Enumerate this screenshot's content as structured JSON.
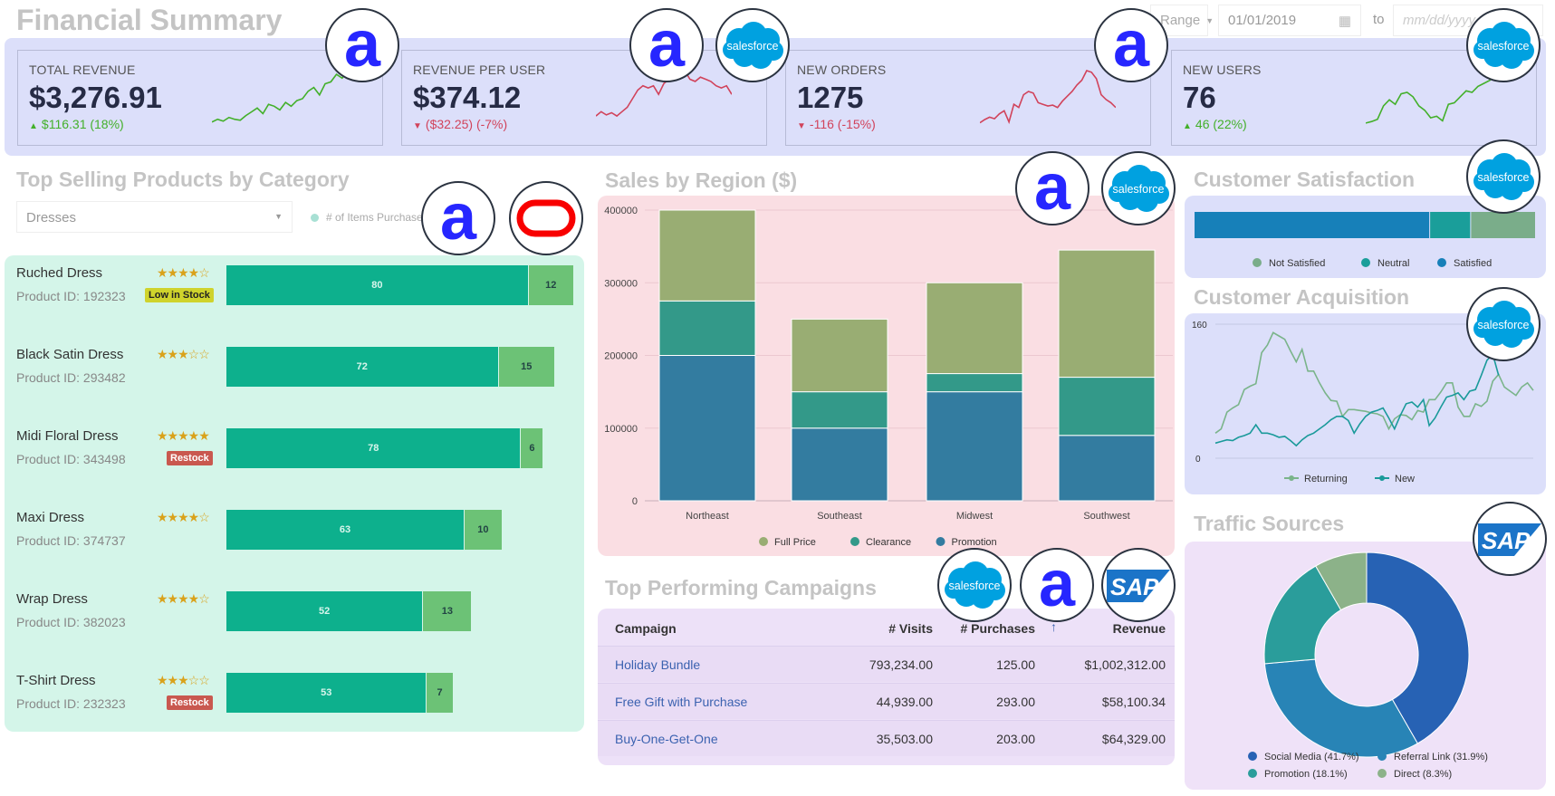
{
  "header": {
    "title": "Financial Summary",
    "range_label": "Range",
    "start_date": "01/01/2019",
    "to_label": "to",
    "end_placeholder": "mm/dd/yyyy"
  },
  "kpis": [
    {
      "label": "TOTAL REVENUE",
      "value": "$3,276.91",
      "change": "$116.31 (18%)",
      "direction": "up",
      "trend": [
        5,
        8,
        6,
        10,
        8,
        7,
        12,
        16,
        20,
        14,
        24,
        22,
        18,
        26,
        22,
        28,
        30,
        38,
        42,
        34,
        46,
        48,
        56,
        52,
        60
      ]
    },
    {
      "label": "REVENUE PER USER",
      "value": "$374.12",
      "change": "($32.25) (-7%)",
      "direction": "down",
      "trend": [
        10,
        14,
        11,
        13,
        10,
        14,
        18,
        26,
        34,
        38,
        36,
        38,
        30,
        40,
        44,
        50,
        48,
        52,
        44,
        42,
        46,
        44,
        42,
        38,
        36,
        38,
        30
      ]
    },
    {
      "label": "NEW ORDERS",
      "value": "1275",
      "change": "-116 (-15%)",
      "direction": "down",
      "trend": [
        5,
        9,
        12,
        10,
        16,
        20,
        6,
        28,
        24,
        40,
        44,
        42,
        30,
        28,
        26,
        27,
        24,
        32,
        38,
        44,
        52,
        58,
        70,
        68,
        60,
        40,
        34,
        30,
        24
      ]
    },
    {
      "label": "NEW USERS",
      "value": "76",
      "change": "46 (22%)",
      "direction": "up",
      "trend": [
        5,
        7,
        10,
        28,
        36,
        30,
        44,
        46,
        40,
        28,
        22,
        12,
        14,
        8,
        30,
        32,
        40,
        48,
        46,
        54,
        58,
        62,
        70,
        75
      ]
    }
  ],
  "products": {
    "title": "Top Selling Products by Category",
    "category": "Dresses",
    "legend": [
      "# of Items Purchased"
    ],
    "items": [
      {
        "name": "Ruched Dress",
        "id": "Product ID: 192323",
        "rating": 4,
        "badge": "Low in Stock",
        "badge_type": "low",
        "purchased": 80,
        "returned": 12
      },
      {
        "name": "Black Satin Dress",
        "id": "Product ID: 293482",
        "rating": 3,
        "badge": "",
        "badge_type": "",
        "purchased": 72,
        "returned": 15
      },
      {
        "name": "Midi Floral Dress",
        "id": "Product ID: 343498",
        "rating": 5,
        "badge": "Restock",
        "badge_type": "restock",
        "purchased": 78,
        "returned": 6
      },
      {
        "name": "Maxi Dress",
        "id": "Product ID: 374737",
        "rating": 4,
        "badge": "",
        "badge_type": "",
        "purchased": 63,
        "returned": 10
      },
      {
        "name": "Wrap Dress",
        "id": "Product ID: 382023",
        "rating": 4,
        "badge": "",
        "badge_type": "",
        "purchased": 52,
        "returned": 13
      },
      {
        "name": "T-Shirt Dress",
        "id": "Product ID: 232323",
        "rating": 3,
        "badge": "Restock",
        "badge_type": "restock",
        "purchased": 53,
        "returned": 7
      }
    ]
  },
  "campaigns": {
    "title": "Top Performing Campaigns",
    "columns": [
      "Campaign",
      "# Visits",
      "# Purchases",
      "Revenue"
    ],
    "rows": [
      [
        "Holiday Bundle",
        "793,234.00",
        "125.00",
        "$1,002,312.00"
      ],
      [
        "Free Gift with Purchase",
        "44,939.00",
        "293.00",
        "$58,100.34"
      ],
      [
        "Buy-One-Get-One",
        "35,503.00",
        "203.00",
        "$64,329.00"
      ]
    ]
  },
  "logos": {
    "a": "a",
    "salesforce": "salesforce",
    "sap": "SAP"
  },
  "chart_data": [
    {
      "type": "bar",
      "stacked": true,
      "title": "Sales by Region ($)",
      "categories": [
        "Northeast",
        "Southeast",
        "Midwest",
        "Southwest"
      ],
      "series": [
        {
          "name": "Promotion",
          "color": "#337ca0",
          "values": [
            200000,
            100000,
            150000,
            90000
          ]
        },
        {
          "name": "Clearance",
          "color": "#339989",
          "values": [
            75000,
            50000,
            25000,
            80000
          ]
        },
        {
          "name": "Full Price",
          "color": "#99ad73",
          "values": [
            125000,
            100000,
            125000,
            175000
          ]
        }
      ],
      "ylim": [
        0,
        400000
      ],
      "yticks": [
        "0",
        "100000",
        "200000",
        "300000",
        "400000"
      ],
      "grid": true,
      "legend": "bottom",
      "legend_order": [
        "Full Price",
        "Clearance",
        "Promotion"
      ]
    },
    {
      "type": "bar",
      "stacked": true,
      "orientation": "horizontal",
      "title": "Customer Satisfaction",
      "series": [
        {
          "name": "Satisfied",
          "color": "#1780b9",
          "value": 69
        },
        {
          "name": "Neutral",
          "color": "#1a9e9a",
          "value": 12
        },
        {
          "name": "Not Satisfied",
          "color": "#7aad8a",
          "value": 19
        }
      ],
      "legend": "bottom",
      "legend_order": [
        "Not Satisfied",
        "Neutral",
        "Satisfied"
      ]
    },
    {
      "type": "line",
      "title": "Customer Acquisition",
      "ylim": [
        0,
        160
      ],
      "yticks": [
        "0",
        "160"
      ],
      "grid": true,
      "legend": "bottom",
      "series": [
        {
          "name": "Returning",
          "color": "#7ab48a",
          "values": [
            30,
            35,
            55,
            60,
            64,
            82,
            86,
            89,
            126,
            135,
            150,
            146,
            142,
            128,
            115,
            130,
            104,
            104,
            90,
            78,
            69,
            68,
            50,
            58,
            58,
            57,
            56,
            54,
            53,
            50,
            35,
            47,
            52,
            51,
            46,
            57,
            55,
            70,
            70,
            79,
            90,
            90,
            61,
            50,
            50,
            65,
            62,
            68,
            92,
            100,
            85,
            80,
            75,
            85,
            90,
            81
          ]
        },
        {
          "name": "New",
          "color": "#1a9a9a",
          "values": [
            18,
            20,
            22,
            21,
            25,
            27,
            30,
            40,
            30,
            30,
            28,
            25,
            26,
            21,
            15,
            22,
            27,
            30,
            35,
            40,
            46,
            50,
            50,
            45,
            30,
            41,
            50,
            55,
            57,
            60,
            48,
            35,
            51,
            65,
            67,
            61,
            70,
            39,
            48,
            61,
            73,
            75,
            78,
            70,
            80,
            82,
            99,
            117,
            124,
            99
          ]
        }
      ]
    },
    {
      "type": "pie",
      "donut": true,
      "title": "Traffic Sources",
      "legend": "bottom",
      "slices": [
        {
          "label": "Social Media (41.7%)",
          "value": 41.7,
          "color": "#2762b4"
        },
        {
          "label": "Referral Link (31.9%)",
          "value": 31.9,
          "color": "#2884b6"
        },
        {
          "label": "Promotion (18.1%)",
          "value": 18.1,
          "color": "#2a9d9b"
        },
        {
          "label": "Direct (8.3%)",
          "value": 8.3,
          "color": "#8cb289"
        }
      ]
    }
  ]
}
